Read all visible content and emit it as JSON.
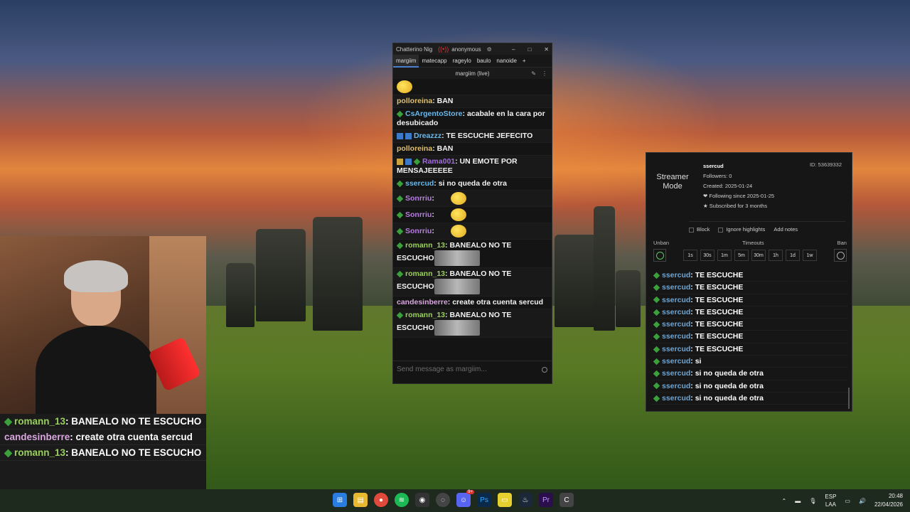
{
  "chatterino": {
    "title": "Chatterino Nig",
    "account": "anonymous",
    "tabs": [
      "margiim",
      "matecapp",
      "rageylo",
      "baulo",
      "nanoide"
    ],
    "add_tab": "+",
    "channel": "margiim (live)",
    "messages": [
      {
        "user": "polloreina",
        "text": "BAN",
        "color": "gold",
        "badges": []
      },
      {
        "user": "CsArgentoStore",
        "text": "acabale en la cara por desubicado",
        "color": "cyan",
        "badges": [
          "green"
        ]
      },
      {
        "user": "Dreazzz",
        "text": "TE ESCUCHE JEFECITO",
        "color": "cyan",
        "badges": [
          "blue",
          "blue"
        ]
      },
      {
        "user": "polloreina",
        "text": "BAN",
        "color": "gold",
        "badges": []
      },
      {
        "user": "Rama001",
        "text": "UN EMOTE POR MENSAJEEEEE",
        "color": "violet",
        "badges": [
          "gold",
          "blue",
          "green"
        ]
      },
      {
        "user": "ssercud",
        "text": "si no queda de otra",
        "color": "cyan",
        "badges": [
          "green"
        ]
      },
      {
        "user": "Sonrriu",
        "text": "",
        "color": "purple",
        "badges": [
          "green"
        ]
      },
      {
        "user": "Sonrriu",
        "text": "",
        "color": "purple",
        "badges": [
          "green"
        ]
      },
      {
        "user": "Sonrriu",
        "text": "",
        "color": "purple",
        "badges": [
          "green"
        ]
      },
      {
        "user": "romann_13",
        "text": "BANEALO NO TE ESCUCHO",
        "color": "green",
        "badges": [
          "green"
        ]
      },
      {
        "user": "romann_13",
        "text": "BANEALO NO TE ESCUCHO",
        "color": "green",
        "badges": [
          "green"
        ]
      },
      {
        "user": "candesinberre",
        "text": "create otra cuenta sercud",
        "color": "pink",
        "badges": []
      },
      {
        "user": "romann_13",
        "text": "BANEALO NO TE ESCUCHO",
        "color": "green",
        "badges": [
          "green"
        ]
      }
    ],
    "input_placeholder": "Send message as margiim..."
  },
  "popup": {
    "streamer_mode": "Streamer Mode",
    "username": "ssercud",
    "followers": "Followers: 0",
    "created": "Created: 2025-01-24",
    "following": "❤ Following since 2025-01-25",
    "subscribed": "★ Subscribed for 3 months",
    "user_id": "ID: 53639332",
    "block": "Block",
    "ignore": "Ignore highlights",
    "notes": "Add notes",
    "unban": "Unban",
    "timeouts_label": "Timeouts",
    "ban": "Ban",
    "timeouts": [
      "1s",
      "30s",
      "1m",
      "5m",
      "30m",
      "1h",
      "1d",
      "1w"
    ],
    "messages": [
      {
        "user": "ssercud",
        "text": "TE ESCUCHE"
      },
      {
        "user": "ssercud",
        "text": "TE ESCUCHE"
      },
      {
        "user": "ssercud",
        "text": "TE ESCUCHE"
      },
      {
        "user": "ssercud",
        "text": "TE ESCUCHE"
      },
      {
        "user": "ssercud",
        "text": "TE ESCUCHE"
      },
      {
        "user": "ssercud",
        "text": "TE ESCUCHE"
      },
      {
        "user": "ssercud",
        "text": "TE ESCUCHE"
      },
      {
        "user": "ssercud",
        "text": "si"
      },
      {
        "user": "ssercud",
        "text": "si no queda de otra"
      },
      {
        "user": "ssercud",
        "text": "si no queda de otra"
      },
      {
        "user": "ssercud",
        "text": "si no queda de otra"
      }
    ]
  },
  "overlay": {
    "messages": [
      {
        "user": "romann_13",
        "text": "BANEALO NO TE ESCUCHO",
        "color": "green",
        "badge": true
      },
      {
        "user": "candesinberre",
        "text": "create otra cuenta sercud",
        "color": "pink",
        "badge": false
      },
      {
        "user": "romann_13",
        "text": "BANEALO NO TE ESCUCHO",
        "color": "green",
        "badge": true
      }
    ]
  },
  "taskbar": {
    "lang_top": "ESP",
    "lang_bottom": "LAA",
    "time": "20:48",
    "date": "22/04/2026",
    "discord_badge": "9+"
  }
}
